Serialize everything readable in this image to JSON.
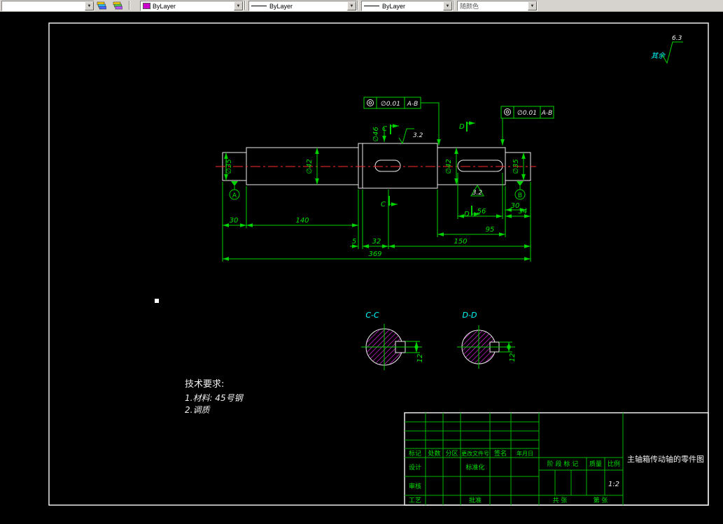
{
  "toolbar": {
    "layer_value": "",
    "color": {
      "value": "ByLayer",
      "swatch": "#cc00cc"
    },
    "linetype": {
      "value": "ByLayer"
    },
    "lineweight": {
      "value": "ByLayer"
    },
    "plotstyle": {
      "value": "随颜色"
    }
  },
  "drawing": {
    "surface": {
      "rest": "其余",
      "overall": "6.3",
      "top": "3.2",
      "keyway": "3.2"
    },
    "gdt": [
      {
        "symbol": "concentricity",
        "tol": "∅0.01",
        "datum": "A-B"
      },
      {
        "symbol": "concentricity",
        "tol": "∅0.01",
        "datum": "A-B"
      }
    ],
    "datum": {
      "a": "A",
      "b": "B"
    },
    "dia": {
      "d35l": "∅35",
      "d42l": "∅42",
      "d46": "∅46",
      "d42r": "∅42",
      "d35r": "∅35"
    },
    "dims": {
      "l30": "30",
      "l140": "140",
      "l5": "5",
      "l32": "32",
      "l150": "150",
      "l369": "369",
      "l56": "56",
      "l34": "34",
      "r30": "30",
      "l95": "95"
    },
    "cuts": {
      "c": "C",
      "d": "D"
    },
    "secC": {
      "label": "C-C",
      "dim": "12"
    },
    "secD": {
      "label": "D-D",
      "dim": "12"
    },
    "tech": {
      "t0": "技术要求:",
      "t1": "1.材料: 45号钢",
      "t2": "2.调质"
    }
  },
  "titleblock": {
    "h": {
      "c1": "标记",
      "c2": "处数",
      "c3": "分区",
      "c4": "更改文件号",
      "c5": "签名",
      "c6": "年月日"
    },
    "r": {
      "design": "设计",
      "std": "标准化",
      "check": "审核",
      "proc": "工艺",
      "appr": "批准"
    },
    "stage": "阶 段 标 记",
    "mass": "质量",
    "scale": "比例",
    "scaleval": "1:2",
    "sheets": "共  张",
    "sheetno": "第  张",
    "title": "主轴箱传动轴的零件图"
  }
}
